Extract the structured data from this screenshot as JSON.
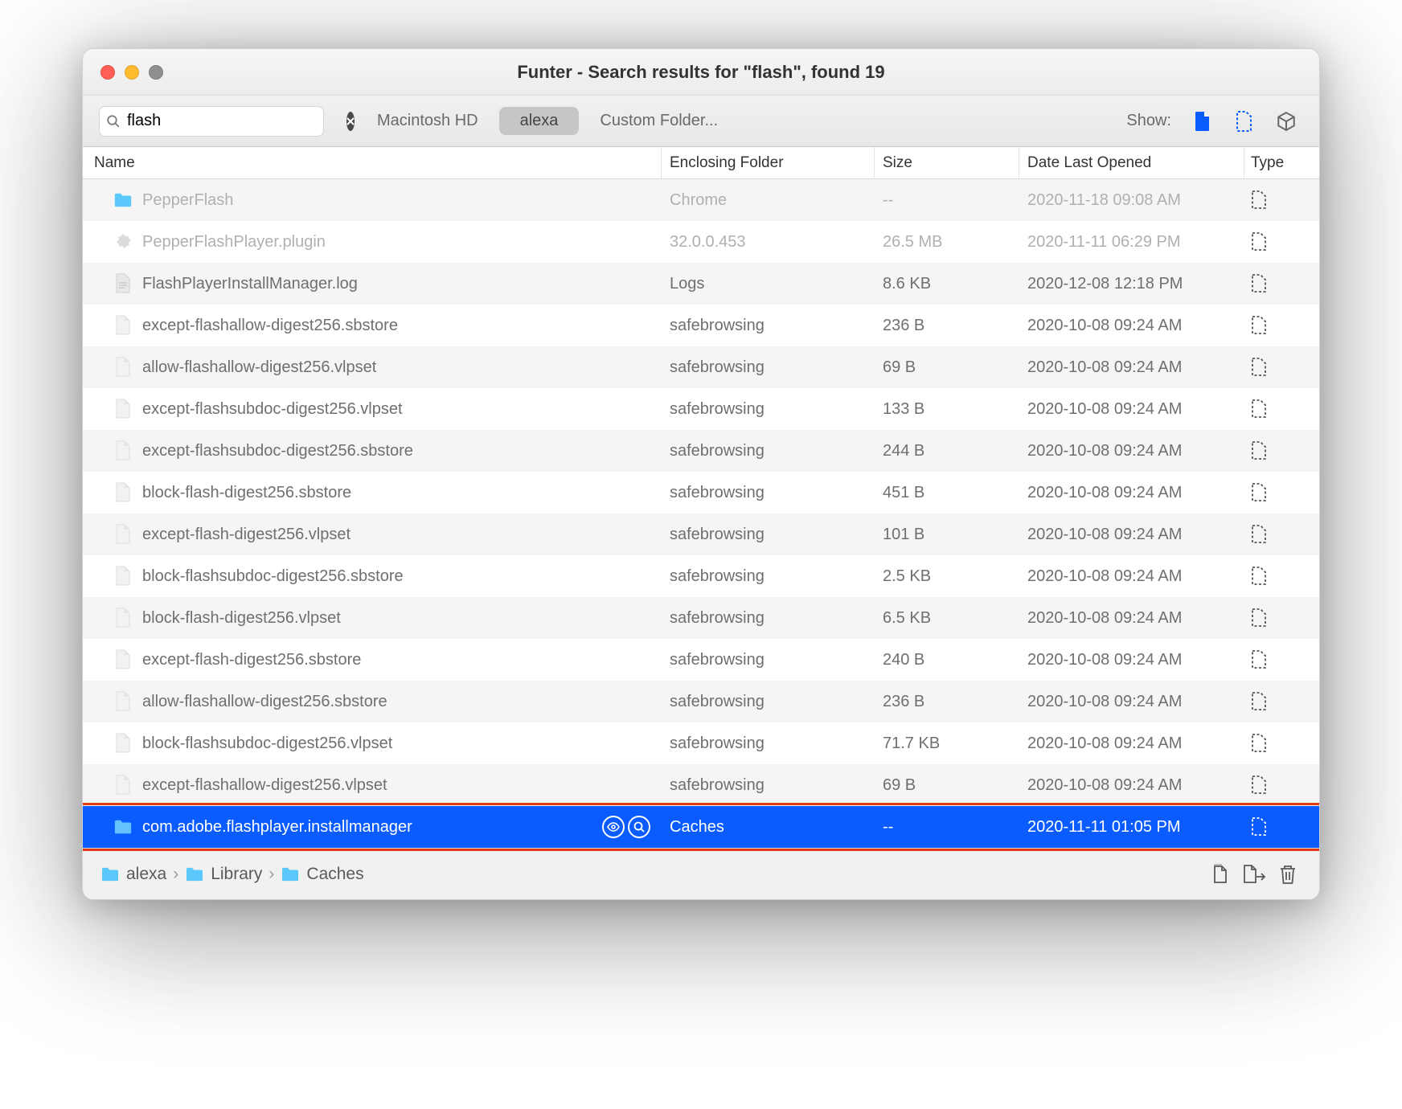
{
  "title": "Funter - Search results for \"flash\", found 19",
  "search": {
    "value": "flash",
    "placeholder": "Search"
  },
  "scopes": [
    {
      "label": "Macintosh HD",
      "active": false
    },
    {
      "label": "alexa",
      "active": true
    },
    {
      "label": "Custom Folder...",
      "active": false
    }
  ],
  "show_label": "Show:",
  "columns": {
    "name": "Name",
    "enclosing": "Enclosing Folder",
    "size": "Size",
    "date": "Date Last Opened",
    "type": "Type"
  },
  "rows": [
    {
      "icon": "folder",
      "name": "PepperFlash",
      "enc": "Chrome",
      "size": "--",
      "date": "2020-11-18 09:08 AM",
      "dim": true,
      "selected": false
    },
    {
      "icon": "plugin",
      "name": "PepperFlashPlayer.plugin",
      "enc": "32.0.0.453",
      "size": "26.5 MB",
      "date": "2020-11-11 06:29 PM",
      "dim": true,
      "selected": false
    },
    {
      "icon": "doc",
      "name": "FlashPlayerInstallManager.log",
      "enc": "Logs",
      "size": "8.6 KB",
      "date": "2020-12-08 12:18 PM",
      "dim": false,
      "selected": false
    },
    {
      "icon": "file",
      "name": "except-flashallow-digest256.sbstore",
      "enc": "safebrowsing",
      "size": "236 B",
      "date": "2020-10-08 09:24 AM",
      "dim": false,
      "selected": false
    },
    {
      "icon": "file",
      "name": "allow-flashallow-digest256.vlpset",
      "enc": "safebrowsing",
      "size": "69 B",
      "date": "2020-10-08 09:24 AM",
      "dim": false,
      "selected": false
    },
    {
      "icon": "file",
      "name": "except-flashsubdoc-digest256.vlpset",
      "enc": "safebrowsing",
      "size": "133 B",
      "date": "2020-10-08 09:24 AM",
      "dim": false,
      "selected": false
    },
    {
      "icon": "file",
      "name": "except-flashsubdoc-digest256.sbstore",
      "enc": "safebrowsing",
      "size": "244 B",
      "date": "2020-10-08 09:24 AM",
      "dim": false,
      "selected": false
    },
    {
      "icon": "file",
      "name": "block-flash-digest256.sbstore",
      "enc": "safebrowsing",
      "size": "451 B",
      "date": "2020-10-08 09:24 AM",
      "dim": false,
      "selected": false
    },
    {
      "icon": "file",
      "name": "except-flash-digest256.vlpset",
      "enc": "safebrowsing",
      "size": "101 B",
      "date": "2020-10-08 09:24 AM",
      "dim": false,
      "selected": false
    },
    {
      "icon": "file",
      "name": "block-flashsubdoc-digest256.sbstore",
      "enc": "safebrowsing",
      "size": "2.5 KB",
      "date": "2020-10-08 09:24 AM",
      "dim": false,
      "selected": false
    },
    {
      "icon": "file",
      "name": "block-flash-digest256.vlpset",
      "enc": "safebrowsing",
      "size": "6.5 KB",
      "date": "2020-10-08 09:24 AM",
      "dim": false,
      "selected": false
    },
    {
      "icon": "file",
      "name": "except-flash-digest256.sbstore",
      "enc": "safebrowsing",
      "size": "240 B",
      "date": "2020-10-08 09:24 AM",
      "dim": false,
      "selected": false
    },
    {
      "icon": "file",
      "name": "allow-flashallow-digest256.sbstore",
      "enc": "safebrowsing",
      "size": "236 B",
      "date": "2020-10-08 09:24 AM",
      "dim": false,
      "selected": false
    },
    {
      "icon": "file",
      "name": "block-flashsubdoc-digest256.vlpset",
      "enc": "safebrowsing",
      "size": "71.7 KB",
      "date": "2020-10-08 09:24 AM",
      "dim": false,
      "selected": false
    },
    {
      "icon": "file",
      "name": "except-flashallow-digest256.vlpset",
      "enc": "safebrowsing",
      "size": "69 B",
      "date": "2020-10-08 09:24 AM",
      "dim": false,
      "selected": false
    },
    {
      "icon": "folder",
      "name": "com.adobe.flashplayer.installmanager",
      "enc": "Caches",
      "size": "--",
      "date": "2020-11-11 01:05 PM",
      "dim": false,
      "selected": true
    }
  ],
  "selected_actions": [
    "eye",
    "search"
  ],
  "breadcrumb": [
    "alexa",
    "Library",
    "Caches"
  ]
}
